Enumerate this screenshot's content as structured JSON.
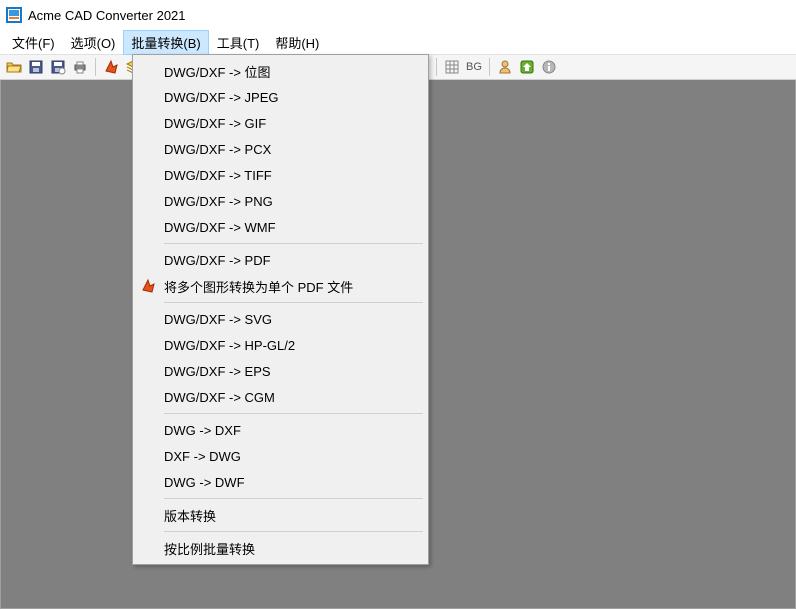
{
  "titlebar": {
    "title": "Acme CAD Converter 2021"
  },
  "menubar": {
    "file": "文件(F)",
    "options": "选项(O)",
    "batch": "批量转换(B)",
    "tools": "工具(T)",
    "help": "帮助(H)"
  },
  "toolbar": {
    "bg_label": "BG"
  },
  "dropdown": {
    "to_bitmap": "DWG/DXF -> 位图",
    "to_jpeg": "DWG/DXF -> JPEG",
    "to_gif": "DWG/DXF -> GIF",
    "to_pcx": "DWG/DXF -> PCX",
    "to_tiff": "DWG/DXF -> TIFF",
    "to_png": "DWG/DXF -> PNG",
    "to_wmf": "DWG/DXF -> WMF",
    "to_pdf": "DWG/DXF -> PDF",
    "multi_pdf": "将多个图形转换为单个 PDF 文件",
    "to_svg": "DWG/DXF -> SVG",
    "to_hpgl": "DWG/DXF -> HP-GL/2",
    "to_eps": "DWG/DXF -> EPS",
    "to_cgm": "DWG/DXF -> CGM",
    "dwg_dxf": "DWG -> DXF",
    "dxf_dwg": "DXF -> DWG",
    "dwg_dwf": "DWG -> DWF",
    "version_convert": "版本转换",
    "scale_batch": "按比例批量转换"
  }
}
